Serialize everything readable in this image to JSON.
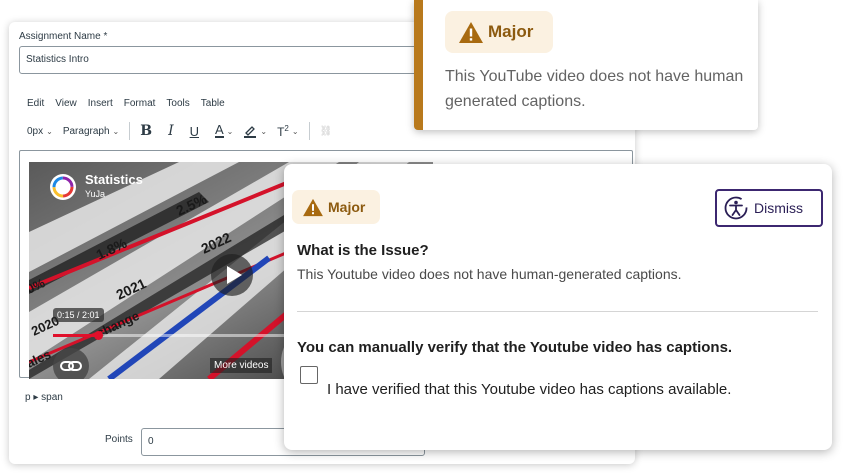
{
  "editor": {
    "assignment_label": "Assignment Name *",
    "assignment_value": "Statistics Intro",
    "menu": [
      "Edit",
      "View",
      "Insert",
      "Format",
      "Tools",
      "Table"
    ],
    "font_size": "0px",
    "block_format": "Paragraph",
    "path": "p ▸ span",
    "points_label": "Points",
    "points_value": "0"
  },
  "video": {
    "title": "Statistics",
    "channel": "YuJa",
    "time": "0:15 / 2:01",
    "progress": 0.12,
    "more_videos": "More videos"
  },
  "top_popup": {
    "severity": "Major",
    "message": "This YouTube video does not have human generated captions.",
    "accent": "#b8791c"
  },
  "main_popup": {
    "severity": "Major",
    "dismiss_label": "Dismiss",
    "issue_title": "What is the Issue?",
    "issue_desc": "This Youtube video does not have human-generated captions.",
    "verify_title": "You can manually verify that the Youtube video has captions.",
    "checkbox_label": "I have verified that this Youtube video has captions available.",
    "checked": false
  }
}
